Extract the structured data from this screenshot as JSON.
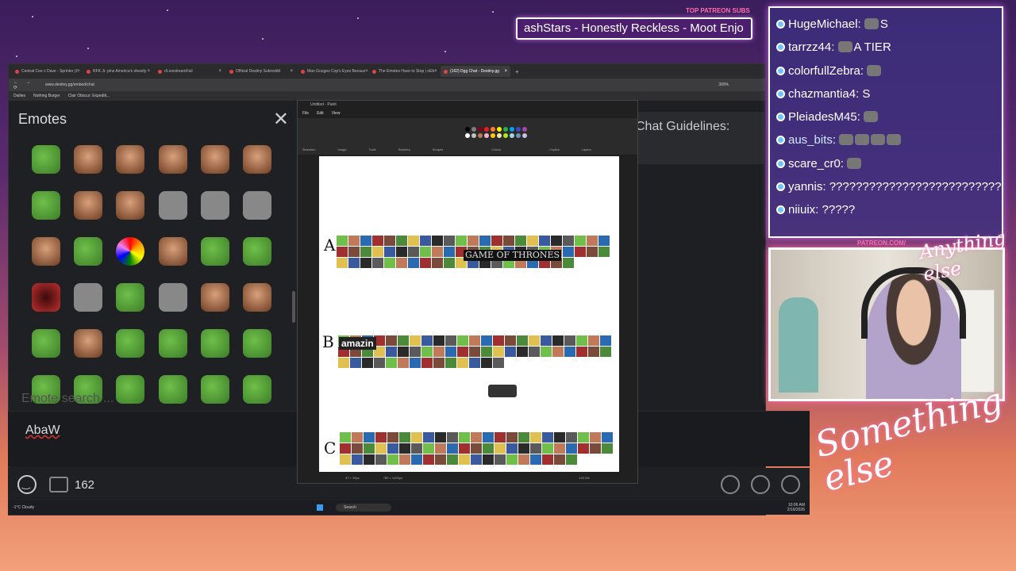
{
  "patreon": {
    "subs_label": "TOP PATREON SUBS",
    "ticker": "ashStars - Honestly Reckless - Moot Enjo",
    "url": "PATREON.COM/",
    "logo": "Anything else"
  },
  "chat_overlay": {
    "messages": [
      {
        "user": "HugeMichael",
        "text": "S",
        "emotes": 1
      },
      {
        "user": "tarrzz44",
        "text": "A TIER",
        "emotes": 1
      },
      {
        "user": "colorfullZebra",
        "text": "",
        "emotes": 1
      },
      {
        "user": "chazmantia4",
        "text": "S",
        "emotes": 0
      },
      {
        "user": "PleiadesM45",
        "text": "",
        "emotes": 1
      },
      {
        "user": "aus_bits",
        "text": "",
        "emotes": 4
      },
      {
        "user": "scare_cr0",
        "text": "",
        "emotes": 1
      },
      {
        "user": "yannis",
        "text": "??????????????????????????????",
        "emotes": 0
      },
      {
        "user": "niiuix",
        "text": "?????",
        "emotes": 0
      }
    ]
  },
  "browser": {
    "tabs": [
      {
        "label": "Central Cee x Dave - Sprinter (t"
      },
      {
        "label": "RFK Jr. pins America's obesity"
      },
      {
        "label": "r/LivestreamFail"
      },
      {
        "label": "Official Destiny Subreddit"
      },
      {
        "label": "Man Gouges Cop's Eyes Becaus"
      },
      {
        "label": "The Emotes Have to Stop | oEb"
      },
      {
        "label": "(162) Dgg Chat - Destiny.gg",
        "active": true
      }
    ],
    "url": "www.destiny.gg/embed/chat",
    "zoom": "300%",
    "bookmarks": [
      "Dailies",
      "Nothing Burger",
      "Clair Obscur: Expediti..."
    ]
  },
  "emotes_panel": {
    "title": "Emotes",
    "search_placeholder": "Emote search ...",
    "emotes": [
      "pepe",
      "face",
      "face",
      "face",
      "face",
      "face",
      "pepe",
      "face",
      "face",
      "stone",
      "stone",
      "stone",
      "face",
      "pepe",
      "rainbow",
      "face",
      "pepe",
      "pepe",
      "red",
      "stone",
      "pepe",
      "stone",
      "face",
      "face",
      "pepe",
      "face",
      "pepe",
      "pepe",
      "pepe",
      "pepe",
      "pepe",
      "pepe",
      "pepe",
      "pepe",
      "pepe",
      "pepe"
    ]
  },
  "chat": {
    "guidelines": "Chat Guidelines:",
    "input_text": "AbaW",
    "user_count": "162"
  },
  "paint": {
    "title": "Untitled - Paint",
    "menu": [
      "File",
      "Edit",
      "View"
    ],
    "ribbon": [
      "Selection",
      "Image",
      "Tools",
      "Brushes",
      "Shapes",
      "Colors",
      "Copilot",
      "Layers"
    ],
    "palette": [
      "#000000",
      "#7f7f7f",
      "#880015",
      "#ed1c24",
      "#ff7f27",
      "#fff200",
      "#22b14c",
      "#00a2e8",
      "#3f48cc",
      "#a349a4",
      "#ffffff",
      "#c3c3c3",
      "#b97a57",
      "#ffaec9",
      "#ffc90e",
      "#efe4b0",
      "#b5e61d",
      "#99d9ea",
      "#7092be",
      "#c8bfe7"
    ],
    "tiers": [
      "A",
      "B",
      "C"
    ],
    "labels": {
      "amazin": "amazin",
      "got": "GAME OF THRONES"
    },
    "status": {
      "pos": "37 × 39px",
      "size": "780 × 1420px",
      "zoom": "122.5%"
    }
  },
  "taskbar": {
    "weather": "-1°C Cloudy",
    "search": "Search",
    "time": "10:06 AM",
    "date": "2/16/2026"
  },
  "branding": {
    "something_else": "Something else"
  }
}
